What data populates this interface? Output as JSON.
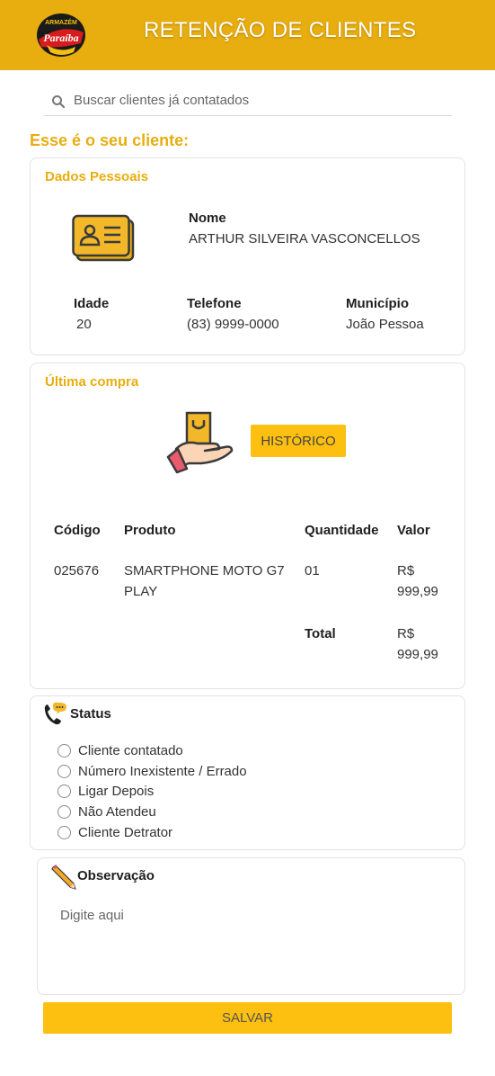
{
  "header": {
    "title": "RETENÇÃO DE CLIENTES",
    "logo_top_text": "ARMAZÉM",
    "logo_main_text": "Paraíba"
  },
  "search": {
    "placeholder": "Buscar clientes já contatados",
    "icon": "search-icon"
  },
  "section_title": "Esse é o seu cliente:",
  "personal": {
    "card_title": "Dados Pessoais",
    "icon": "id-card-icon",
    "name_label": "Nome",
    "name_value": "ARTHUR SILVEIRA VASCONCELLOS",
    "age_label": "Idade",
    "age_value": "20",
    "phone_label": "Telefone",
    "phone_value": "(83) 9999-0000",
    "city_label": "Município",
    "city_value": "João Pessoa"
  },
  "purchase": {
    "card_title": "Última compra",
    "icon": "shopping-bag-hand-icon",
    "history_button": "HISTÓRICO",
    "columns": [
      "Código",
      "Produto",
      "Quantidade",
      "Valor"
    ],
    "row": {
      "code": "025676",
      "product_line1": "SMARTPHONE MOTO G7",
      "product_line2": "PLAY",
      "quantity": "01",
      "value_line1": "R$",
      "value_line2": "999,99"
    },
    "total_label": "Total",
    "total_line1": "R$",
    "total_line2": "999,99"
  },
  "status": {
    "title": "Status",
    "icon": "phone-chat-icon",
    "options": [
      "Cliente contatado",
      "Número Inexistente / Errado",
      "Ligar Depois",
      "Não Atendeu",
      "Cliente Detrator"
    ]
  },
  "observation": {
    "title": "Observação",
    "icon": "pencil-icon",
    "placeholder": "Digite aqui"
  },
  "save_button": "SALVAR",
  "colors": {
    "brand": "#e8ad0f",
    "button": "#fdbf10"
  }
}
